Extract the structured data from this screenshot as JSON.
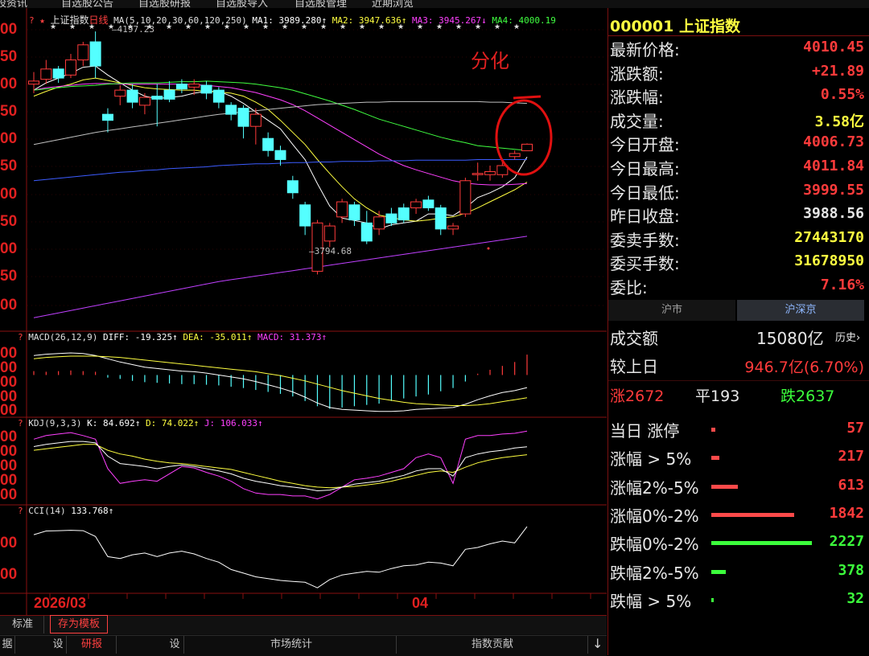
{
  "topbar": [
    "选股资讯",
    "自选股公告",
    "自选股研报",
    "自选股导入",
    "自选股管理",
    "近期浏览"
  ],
  "legend": {
    "title_marks": "? ★",
    "name": "上证指数",
    "period": "日线",
    "ma_params": "MA(5,10,20,30,60,120,250)",
    "ma1": "MA1: 3989.280↑",
    "ma2": "MA2: 3947.636↑",
    "ma3": "MA3: 3945.267↓",
    "ma4": "MA4: 4000.19"
  },
  "annotations": {
    "high": "4197.23",
    "low": "3794.68",
    "handwritten": "分化"
  },
  "yaxis_ticks": [
    "00",
    "50",
    "00",
    "50",
    "00",
    "50",
    "00",
    "50",
    "00",
    "50",
    "00"
  ],
  "x_labels": {
    "start": "2026/03",
    "mid": "04"
  },
  "indicators": {
    "macd": {
      "q": "?",
      "name": "MACD(26,12,9)",
      "diff": "DIFF: -19.325↑",
      "dea": "DEA: -35.011↑",
      "macd": "MACD: 31.373↑",
      "ticks": [
        "00",
        "00",
        "00",
        "00",
        "00"
      ]
    },
    "kdj": {
      "q": "?",
      "name": "KDJ(9,3,3)",
      "k": "K: 84.692↑",
      "d": "D: 74.022↑",
      "j": "J: 106.033↑",
      "ticks": [
        "00",
        "00",
        "00",
        "00",
        "00"
      ]
    },
    "cci": {
      "q": "?",
      "name": "CCI(14)",
      "value": "133.768↑",
      "ticks": [
        "00",
        "00"
      ]
    }
  },
  "chart_data": {
    "type": "candlestick",
    "candles": [
      [
        4110,
        4115,
        4095,
        4130
      ],
      [
        4118,
        4135,
        4110,
        4150
      ],
      [
        4135,
        4120,
        4112,
        4140
      ],
      [
        4125,
        4150,
        4120,
        4160
      ],
      [
        4150,
        4175,
        4140,
        4180
      ],
      [
        4180,
        4140,
        4120,
        4197.23
      ],
      [
        4060,
        4050,
        4030,
        4070
      ],
      [
        4090,
        4100,
        4075,
        4108
      ],
      [
        4100,
        4080,
        4070,
        4110
      ],
      [
        4075,
        4088,
        4060,
        4095
      ],
      [
        4090,
        4085,
        4040,
        4110
      ],
      [
        4100,
        4085,
        4080,
        4115
      ],
      [
        4110,
        4102,
        4095,
        4118
      ],
      [
        4105,
        4110,
        4092,
        4118
      ],
      [
        4108,
        4095,
        4085,
        4115
      ],
      [
        4100,
        4080,
        4070,
        4105
      ],
      [
        4075,
        4060,
        4050,
        4080
      ],
      [
        4070,
        4040,
        4020,
        4075
      ],
      [
        4040,
        4060,
        4010,
        4070
      ],
      [
        4020,
        4000,
        3990,
        4030
      ],
      [
        4000,
        3985,
        3975,
        4008
      ],
      [
        3950,
        3930,
        3920,
        3958
      ],
      [
        3910,
        3875,
        3860,
        3915
      ],
      [
        3800,
        3880,
        3794.68,
        3885
      ],
      [
        3850,
        3875,
        3840,
        3880
      ],
      [
        3890,
        3915,
        3880,
        3920
      ],
      [
        3910,
        3885,
        3875,
        3915
      ],
      [
        3880,
        3850,
        3845,
        3900
      ],
      [
        3870,
        3890,
        3860,
        3900
      ],
      [
        3895,
        3880,
        3875,
        3905
      ],
      [
        3905,
        3885,
        3880,
        3912
      ],
      [
        3905,
        3915,
        3895,
        3920
      ],
      [
        3918,
        3905,
        3900,
        3925
      ],
      [
        3905,
        3870,
        3860,
        3910
      ],
      [
        3870,
        3875,
        3860,
        3880
      ],
      [
        3895,
        3950,
        3890,
        3955
      ],
      [
        3960,
        3962,
        3950,
        3980
      ],
      [
        3960,
        3965,
        3950,
        3975
      ],
      [
        3960,
        3975,
        3955,
        3985
      ],
      [
        3990,
        3995,
        3985,
        4000
      ],
      [
        3999.55,
        4010.45,
        3999.55,
        4011.84
      ]
    ],
    "ymin": 3710,
    "ymax": 4220,
    "series": [
      {
        "name": "MA1",
        "values": [
          4100,
          4112,
          4120,
          4128,
          4138,
          4140,
          4125,
          4112,
          4100,
          4090,
          4086,
          4088,
          4090,
          4095,
          4098,
          4098,
          4090,
          4078,
          4064,
          4050,
          4036,
          4010,
          3985,
          3945,
          3908,
          3888,
          3884,
          3880,
          3870,
          3877,
          3880,
          3883,
          3895,
          3895,
          3892,
          3905,
          3922,
          3930,
          3940,
          3955,
          3989.28
        ]
      },
      {
        "name": "MA2",
        "values": [
          4090,
          4098,
          4105,
          4110,
          4117,
          4120,
          4116,
          4112,
          4108,
          4104,
          4102,
          4101,
          4100,
          4100,
          4098,
          4097,
          4095,
          4090,
          4080,
          4068,
          4050,
          4030,
          4010,
          3985,
          3962,
          3940,
          3920,
          3905,
          3893,
          3889,
          3885,
          3883,
          3885,
          3888,
          3890,
          3896,
          3905,
          3915,
          3925,
          3935,
          3947.64
        ]
      },
      {
        "name": "MA3",
        "values": [
          4100,
          4104,
          4106,
          4108,
          4110,
          4111,
          4111,
          4110,
          4110,
          4110,
          4110,
          4110,
          4110,
          4109,
          4108,
          4106,
          4104,
          4100,
          4096,
          4090,
          4084,
          4076,
          4066,
          4054,
          4042,
          4030,
          4018,
          4006,
          3994,
          3984,
          3975,
          3968,
          3962,
          3956,
          3950,
          3946,
          3944,
          3943,
          3943,
          3944,
          3945.27
        ]
      },
      {
        "name": "MA4",
        "values": [
          4100,
          4102,
          4104,
          4106,
          4107,
          4108,
          4110,
          4111,
          4112,
          4112,
          4112,
          4113,
          4114,
          4114,
          4115,
          4114,
          4113,
          4112,
          4110,
          4107,
          4104,
          4100,
          4094,
          4088,
          4082,
          4075,
          4068,
          4060,
          4052,
          4046,
          4040,
          4034,
          4028,
          4022,
          4017,
          4013,
          4008,
          4006,
          4004,
          4002,
          4000.19
        ]
      },
      {
        "name": "MA5",
        "values": [
          4010,
          4014,
          4018,
          4022,
          4026,
          4030,
          4033,
          4036,
          4039,
          4042,
          4045,
          4048,
          4051,
          4054,
          4057,
          4060,
          4062,
          4064,
          4066,
          4068,
          4070,
          4072,
          4074,
          4076,
          4077,
          4078,
          4079,
          4080,
          4080,
          4081,
          4081,
          4081,
          4081,
          4081,
          4081,
          4081,
          4081,
          4080,
          4080,
          4079,
          4078
        ]
      },
      {
        "name": "MA6",
        "values": [
          3950,
          3952,
          3954,
          3956,
          3958,
          3960,
          3962,
          3964,
          3965,
          3967,
          3968,
          3970,
          3971,
          3972,
          3973,
          3975,
          3976,
          3977,
          3978,
          3978,
          3979,
          3980,
          3980,
          3981,
          3981,
          3982,
          3982,
          3982,
          3983,
          3983,
          3983,
          3984,
          3984,
          3984,
          3984,
          3984,
          3985,
          3985,
          3985,
          3985,
          3985
        ]
      },
      {
        "name": "MA7",
        "values": [
          3723,
          3727,
          3731,
          3735,
          3739,
          3743,
          3747,
          3751,
          3755,
          3759,
          3763,
          3767,
          3771,
          3775,
          3779,
          3783,
          3786,
          3789,
          3792,
          3795,
          3798,
          3801,
          3804,
          3807,
          3810,
          3813,
          3816,
          3819,
          3822,
          3825,
          3828,
          3831,
          3834,
          3837,
          3840,
          3843,
          3846,
          3849,
          3852,
          3855,
          3858
        ]
      }
    ],
    "macd_bars": [
      6,
      5,
      6,
      7,
      6,
      5,
      -4,
      -6,
      -9,
      -11,
      -12,
      -13,
      -14,
      -14,
      -15,
      -16,
      -18,
      -20,
      -23,
      -26,
      -29,
      -33,
      -40,
      -48,
      -52,
      -50,
      -48,
      -46,
      -44,
      -40,
      -36,
      -33,
      -30,
      -25,
      -20,
      -10,
      2,
      8,
      14,
      20,
      31.373
    ],
    "diff": [
      30,
      32,
      33,
      34,
      33,
      30,
      25,
      20,
      16,
      12,
      10,
      8,
      6,
      5,
      3,
      0,
      -3,
      -6,
      -10,
      -15,
      -20,
      -26,
      -34,
      -43,
      -50,
      -53,
      -54,
      -55,
      -56,
      -56,
      -55,
      -53,
      -52,
      -51,
      -50,
      -45,
      -38,
      -32,
      -27,
      -24,
      -19.325
    ],
    "dea": [
      25,
      27,
      28,
      29,
      29,
      29,
      28,
      27,
      25,
      23,
      21,
      19,
      17,
      15,
      13,
      11,
      9,
      7,
      5,
      2,
      -1,
      -5,
      -9,
      -14,
      -19,
      -24,
      -28,
      -32,
      -36,
      -39,
      -42,
      -44,
      -45,
      -46,
      -47,
      -47,
      -46,
      -44,
      -41,
      -38,
      -35.011
    ],
    "macd_range": [
      -60,
      55
    ],
    "kdj_k": [
      85,
      88,
      90,
      92,
      92,
      90,
      72,
      62,
      60,
      58,
      55,
      58,
      60,
      58,
      55,
      52,
      48,
      42,
      38,
      35,
      32,
      30,
      28,
      25,
      26,
      30,
      34,
      36,
      38,
      42,
      46,
      52,
      55,
      55,
      45,
      70,
      75,
      78,
      80,
      83,
      84.692
    ],
    "kdj_d": [
      80,
      82,
      84,
      86,
      88,
      88,
      80,
      75,
      72,
      68,
      65,
      63,
      62,
      60,
      58,
      56,
      54,
      50,
      46,
      42,
      38,
      35,
      32,
      30,
      29,
      30,
      31,
      33,
      35,
      38,
      42,
      46,
      50,
      52,
      50,
      57,
      63,
      67,
      70,
      72,
      74.022
    ],
    "kdj_j": [
      95,
      100,
      102,
      104,
      100,
      95,
      55,
      35,
      38,
      40,
      38,
      48,
      58,
      56,
      50,
      45,
      38,
      28,
      22,
      20,
      20,
      18,
      18,
      14,
      20,
      30,
      40,
      42,
      45,
      50,
      55,
      70,
      75,
      70,
      35,
      95,
      100,
      100,
      102,
      103,
      106.033
    ],
    "kdj_range": [
      -5,
      115
    ],
    "cci": [
      90,
      110,
      112,
      114,
      112,
      80,
      -30,
      -40,
      -20,
      -10,
      -30,
      -10,
      0,
      -15,
      -40,
      -60,
      -100,
      -120,
      -140,
      -150,
      -160,
      -165,
      -170,
      -200,
      -155,
      -130,
      -120,
      -110,
      -115,
      -95,
      -80,
      -75,
      -60,
      -65,
      -80,
      10,
      20,
      40,
      55,
      45,
      133.768
    ],
    "cci_range": [
      -230,
      200
    ]
  },
  "right_panel": {
    "code": "000001",
    "name": "上证指数",
    "quote_rows": [
      {
        "label": "最新价格:",
        "value": "4010.45",
        "cls": "red"
      },
      {
        "label": "涨跌额:",
        "value": "+21.89",
        "cls": "red"
      },
      {
        "label": "涨跌幅:",
        "value": "0.55%",
        "cls": "red"
      },
      {
        "label": "成交量:",
        "value": "3.58亿",
        "cls": "yel"
      },
      {
        "label": "今日开盘:",
        "value": "4006.73",
        "cls": "red"
      },
      {
        "label": "今日最高:",
        "value": "4011.84",
        "cls": "red"
      },
      {
        "label": "今日最低:",
        "value": "3999.55",
        "cls": "red"
      },
      {
        "label": "昨日收盘:",
        "value": "3988.56",
        "cls": "wht"
      },
      {
        "label": "委卖手数:",
        "value": "27443170",
        "cls": "yel"
      },
      {
        "label": "委买手数:",
        "value": "31678950",
        "cls": "yel"
      },
      {
        "label": "委比:",
        "value": "7.16%",
        "cls": "red"
      }
    ],
    "tabs": [
      "沪市",
      "沪深京"
    ],
    "turnover_label": "成交额",
    "turnover_value": "15080亿",
    "history_link": "历史",
    "vs_prev_label": "较上日",
    "vs_prev_value": "946.7亿(6.70%)",
    "rise_label": "涨",
    "rise_count": "2672",
    "flat_label": "平",
    "flat_count": "193",
    "fall_label": "跌",
    "fall_count": "2637",
    "dist_rows": [
      {
        "label": "当日 涨停",
        "value": "57",
        "color": "#ff4a4a",
        "bar": 0.02,
        "cls": "red"
      },
      {
        "label": "涨幅 > 5%",
        "value": "217",
        "color": "#ff4a4a",
        "bar": 0.04,
        "cls": "red"
      },
      {
        "label": "涨幅2%-5%",
        "value": "613",
        "color": "#ff4a4a",
        "bar": 0.13,
        "cls": "red"
      },
      {
        "label": "涨幅0%-2%",
        "value": "1842",
        "color": "#ff4a4a",
        "bar": 0.41,
        "cls": "red"
      },
      {
        "label": "跌幅0%-2%",
        "value": "2227",
        "color": "#3cff3c",
        "bar": 0.5,
        "cls": "grn"
      },
      {
        "label": "跌幅2%-5%",
        "value": "378",
        "color": "#3cff3c",
        "bar": 0.07,
        "cls": "grn"
      },
      {
        "label": "跌幅 > 5%",
        "value": "32",
        "color": "#3cff3c",
        "bar": 0.01,
        "cls": "grn"
      }
    ]
  },
  "bottom": {
    "tab_standard": "标准",
    "tab_save_template": "存为模板",
    "row2": [
      "据",
      "设",
      "研报",
      "设",
      "市场统计",
      "指数贡献"
    ]
  },
  "colors": {
    "up": "#ff3b3b",
    "down": "#54ffff",
    "ma1": "#ffffff",
    "ma2": "#ffff40",
    "ma3": "#ff40ff",
    "ma4": "#40ff40",
    "ma5": "#c0c0c0",
    "ma6": "#3c5cff",
    "ma7": "#c040ff"
  }
}
